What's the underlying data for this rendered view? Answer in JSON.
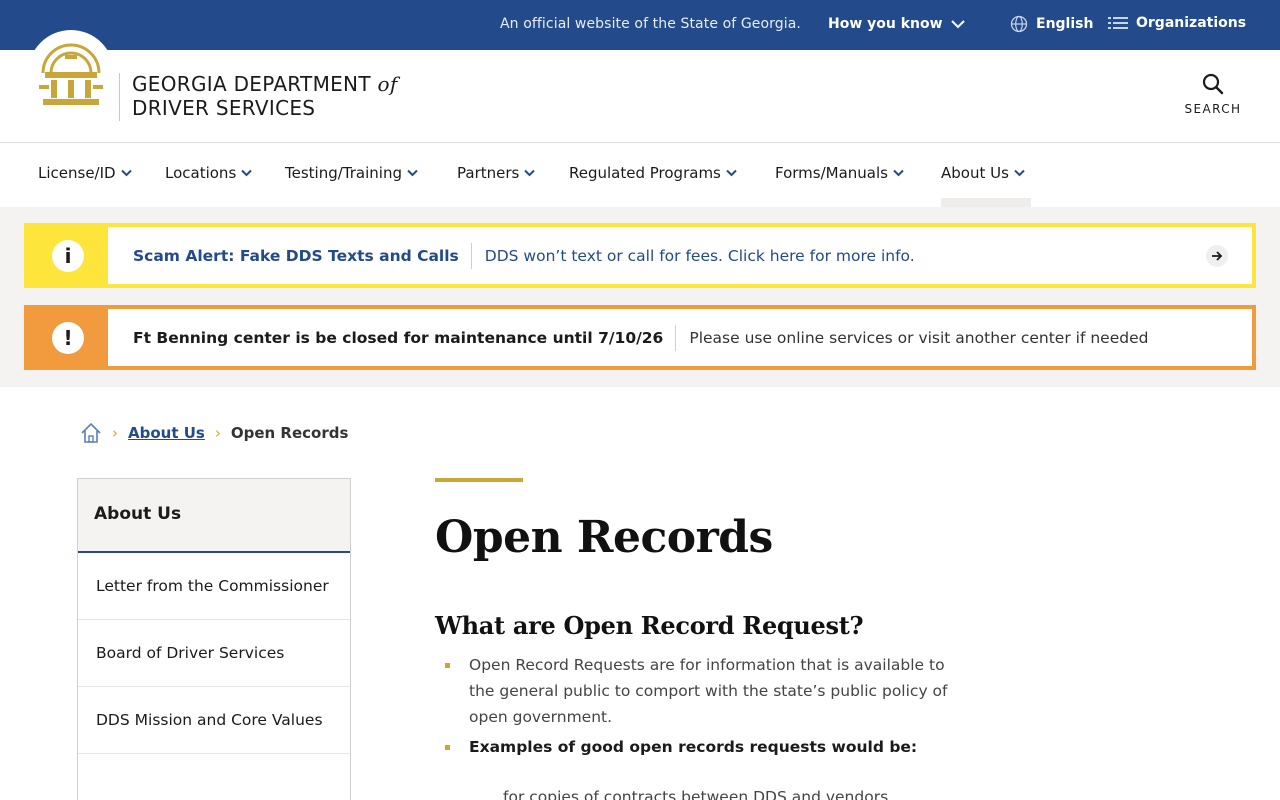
{
  "topbar": {
    "official_text": "An official website of the State of Georgia.",
    "how_you_know": "How you know",
    "language": "English",
    "organizations": "Organizations"
  },
  "header": {
    "agency_line1": "GEORGIA DEPARTMENT",
    "agency_of": "of",
    "agency_line2": "DRIVER SERVICES",
    "search_label": "SEARCH"
  },
  "nav": {
    "items": [
      {
        "label": "License/ID"
      },
      {
        "label": "Locations"
      },
      {
        "label": "Testing/Training"
      },
      {
        "label": "Partners"
      },
      {
        "label": "Regulated Programs"
      },
      {
        "label": "Forms/Manuals"
      },
      {
        "label": "About Us"
      }
    ]
  },
  "alerts": [
    {
      "icon": "i",
      "title": "Scam Alert: Fake DDS Texts and Calls",
      "message": "DDS won’t text or call for fees. Click here for more info.",
      "color": "#fde53b"
    },
    {
      "icon": "!",
      "title": "Ft Benning center is be closed for maintenance until 7/10/26",
      "message": "Please use online services or visit another center if needed",
      "color": "#f19a3e"
    }
  ],
  "breadcrumb": {
    "parent": "About Us",
    "current": "Open Records"
  },
  "sidebar": {
    "heading": "About Us",
    "items": [
      {
        "label": "Letter from the Commissioner"
      },
      {
        "label": "Board of Driver Services"
      },
      {
        "label": "DDS Mission and Core Values"
      }
    ]
  },
  "main": {
    "title": "Open Records",
    "subtitle": "What are Open Record Request?",
    "bullets": [
      "Open Record Requests are for information that is available to the general public to comport with the state’s public policy of open government.",
      "Examples of good open records requests would be:"
    ],
    "sub_bullet": "for copies of contracts between DDS and vendors"
  },
  "colors": {
    "brand_blue": "#234a8a",
    "gold": "#c9a63a",
    "alert_yellow": "#fde53b",
    "alert_orange": "#f19a3e"
  }
}
